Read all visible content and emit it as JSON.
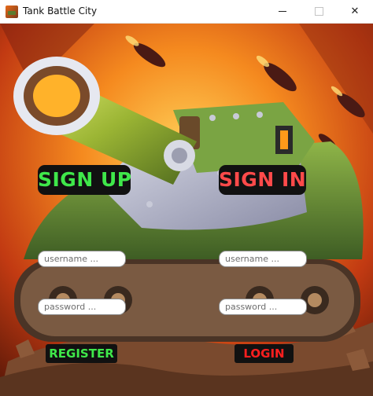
{
  "window": {
    "title": "Tank Battle City",
    "icon": "tank-app-icon",
    "controls": [
      "minimize-icon",
      "maximize-icon",
      "close-icon"
    ]
  },
  "signup": {
    "heading": "SIGN UP",
    "username_placeholder": "username ...",
    "username_value": "",
    "password_placeholder": "password ...",
    "password_value": "",
    "button_label": "REGISTER"
  },
  "signin": {
    "heading": "SIGN IN",
    "username_placeholder": "username ...",
    "username_value": "",
    "password_placeholder": "password ...",
    "password_value": "",
    "button_label": "LOGIN"
  },
  "colors": {
    "signup_accent": "#3fe84a",
    "signin_accent": "#ff4a4a",
    "login_accent": "#ff1f1f",
    "panel_bg": "#111111"
  }
}
